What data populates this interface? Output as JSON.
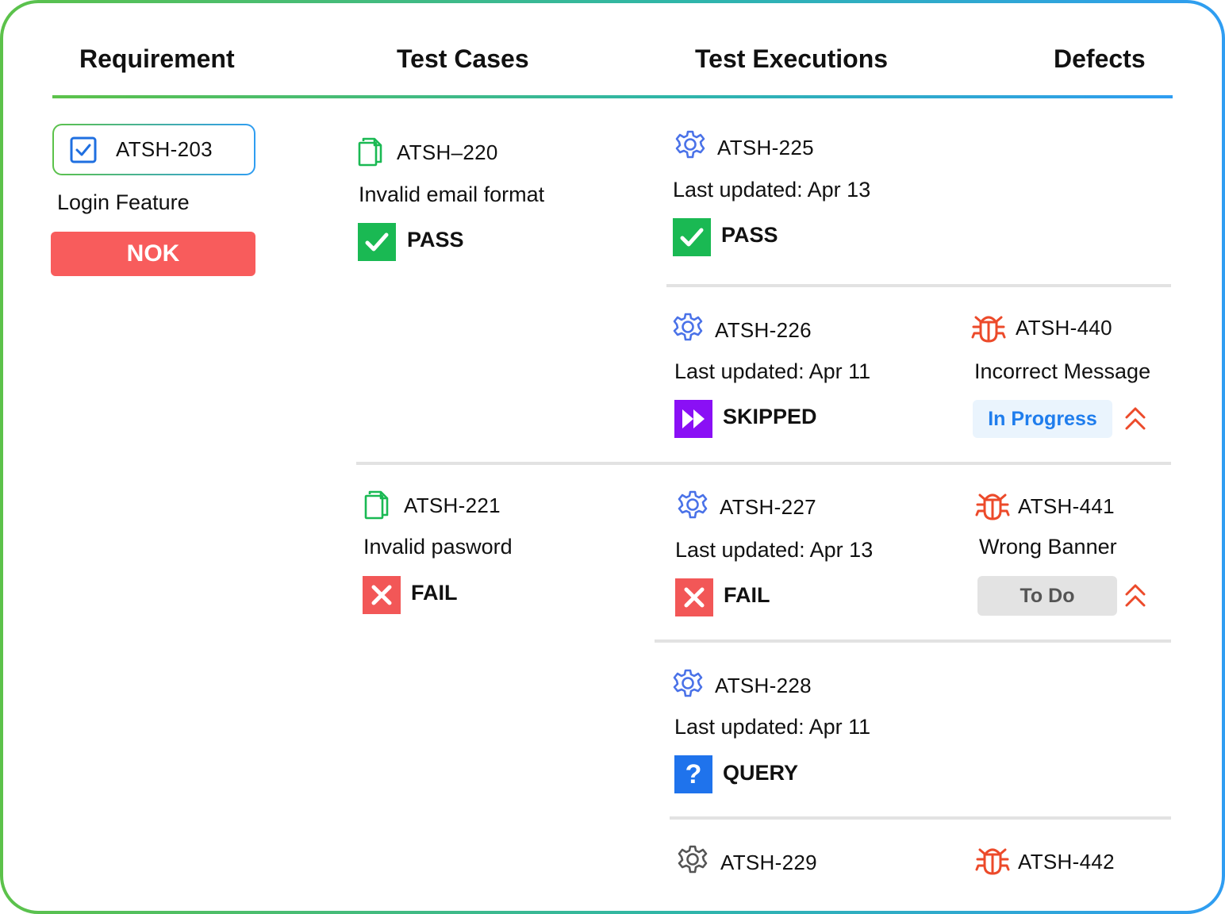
{
  "columns": {
    "requirement": "Requirement",
    "test_cases": "Test Cases",
    "test_executions": "Test Executions",
    "defects": "Defects"
  },
  "requirement": {
    "id": "ATSH-203",
    "title": "Login Feature",
    "status": "NOK",
    "status_color": "#f85c5c"
  },
  "test_cases": [
    {
      "id": "ATSH–220",
      "title": "Invalid email format",
      "status": "PASS",
      "icon": "document-copy-icon"
    },
    {
      "id": "ATSH-221",
      "title": "Invalid pasword",
      "status": "FAIL",
      "icon": "document-copy-icon"
    }
  ],
  "test_executions": [
    {
      "id": "ATSH-225",
      "updated_label": "Last updated:",
      "updated_date": "Apr 13",
      "status": "PASS",
      "icon": "gear-icon"
    },
    {
      "id": "ATSH-226",
      "updated_label": "Last updated:",
      "updated_date": "Apr 11",
      "status": "SKIPPED",
      "icon": "gear-icon"
    },
    {
      "id": "ATSH-227",
      "updated_label": "Last updated:",
      "updated_date": "Apr 13",
      "status": "FAIL",
      "icon": "gear-icon"
    },
    {
      "id": "ATSH-228",
      "updated_label": "Last updated:",
      "updated_date": "Apr 11",
      "status": "QUERY",
      "icon": "gear-icon",
      "query_symbol": "?"
    },
    {
      "id": "ATSH-229",
      "icon": "gear-icon"
    }
  ],
  "defects": [
    {
      "id": "ATSH-440",
      "title": "Incorrect Message",
      "status": "In Progress",
      "icon": "bug-icon",
      "priority_icon": "double-chevron-up-icon"
    },
    {
      "id": "ATSH-441",
      "title": "Wrong Banner",
      "status": "To Do",
      "icon": "bug-icon",
      "priority_icon": "double-chevron-up-icon"
    },
    {
      "id": "ATSH-442",
      "icon": "bug-icon"
    }
  ],
  "colors": {
    "pass": "#1ab953",
    "fail": "#f25757",
    "skipped": "#8a10f5",
    "query": "#1f73ec",
    "gear_active": "#4a72e8",
    "gear_inactive": "#555555",
    "bug": "#ec4a2a",
    "doc": "#1ab953",
    "gradient_start": "#5cc24a",
    "gradient_end": "#2f9df2"
  }
}
